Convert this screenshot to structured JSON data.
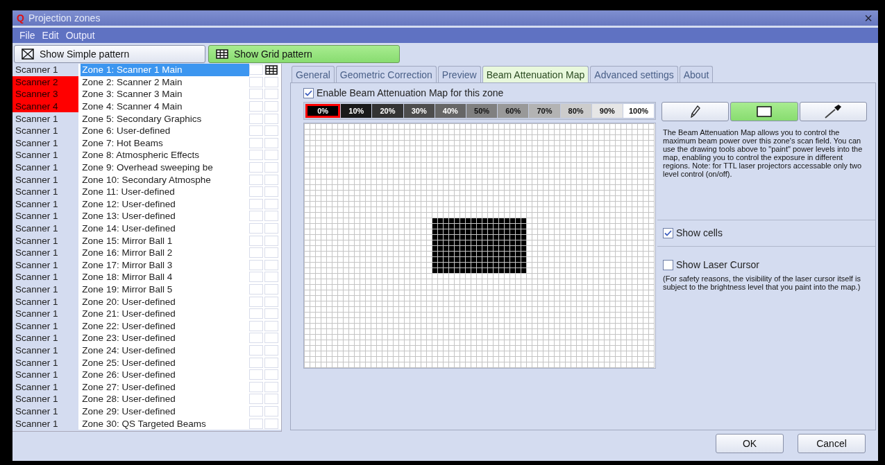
{
  "window": {
    "app_icon": "Q",
    "title": "Projection zones",
    "close": "×"
  },
  "menu": [
    "File",
    "Edit",
    "Output"
  ],
  "toolbar": [
    {
      "label": "Show Simple pattern",
      "kind": "simple",
      "selected": false
    },
    {
      "label": "Show Grid pattern",
      "kind": "grid",
      "selected": true
    }
  ],
  "zones": [
    {
      "scanner": "Scanner 1",
      "name": "Zone 1: Scanner 1 Main",
      "selected": true,
      "conflict": false,
      "simple_pattern": false,
      "grid_pattern": true
    },
    {
      "scanner": "Scanner 2",
      "name": "Zone 2: Scanner 2 Main",
      "selected": false,
      "conflict": true,
      "simple_pattern": false,
      "grid_pattern": false
    },
    {
      "scanner": "Scanner 3",
      "name": "Zone 3: Scanner 3 Main",
      "selected": false,
      "conflict": true,
      "simple_pattern": false,
      "grid_pattern": false
    },
    {
      "scanner": "Scanner 4",
      "name": "Zone 4: Scanner 4 Main",
      "selected": false,
      "conflict": true,
      "simple_pattern": false,
      "grid_pattern": false
    },
    {
      "scanner": "Scanner 1",
      "name": "Zone 5: Secondary Graphics",
      "selected": false,
      "conflict": false,
      "simple_pattern": false,
      "grid_pattern": false
    },
    {
      "scanner": "Scanner 1",
      "name": "Zone 6: User-defined",
      "selected": false,
      "conflict": false,
      "simple_pattern": false,
      "grid_pattern": false
    },
    {
      "scanner": "Scanner 1",
      "name": "Zone 7: Hot Beams",
      "selected": false,
      "conflict": false,
      "simple_pattern": false,
      "grid_pattern": false
    },
    {
      "scanner": "Scanner 1",
      "name": "Zone 8: Atmospheric Effects",
      "selected": false,
      "conflict": false,
      "simple_pattern": false,
      "grid_pattern": false
    },
    {
      "scanner": "Scanner 1",
      "name": "Zone 9: Overhead sweeping be",
      "selected": false,
      "conflict": false,
      "simple_pattern": false,
      "grid_pattern": false
    },
    {
      "scanner": "Scanner 1",
      "name": "Zone 10: Secondary Atmosphe",
      "selected": false,
      "conflict": false,
      "simple_pattern": false,
      "grid_pattern": false
    },
    {
      "scanner": "Scanner 1",
      "name": "Zone 11: User-defined",
      "selected": false,
      "conflict": false,
      "simple_pattern": false,
      "grid_pattern": false
    },
    {
      "scanner": "Scanner 1",
      "name": "Zone 12: User-defined",
      "selected": false,
      "conflict": false,
      "simple_pattern": false,
      "grid_pattern": false
    },
    {
      "scanner": "Scanner 1",
      "name": "Zone 13: User-defined",
      "selected": false,
      "conflict": false,
      "simple_pattern": false,
      "grid_pattern": false
    },
    {
      "scanner": "Scanner 1",
      "name": "Zone 14: User-defined",
      "selected": false,
      "conflict": false,
      "simple_pattern": false,
      "grid_pattern": false
    },
    {
      "scanner": "Scanner 1",
      "name": "Zone 15: Mirror Ball 1",
      "selected": false,
      "conflict": false,
      "simple_pattern": false,
      "grid_pattern": false
    },
    {
      "scanner": "Scanner 1",
      "name": "Zone 16: Mirror Ball 2",
      "selected": false,
      "conflict": false,
      "simple_pattern": false,
      "grid_pattern": false
    },
    {
      "scanner": "Scanner 1",
      "name": "Zone 17: Mirror Ball 3",
      "selected": false,
      "conflict": false,
      "simple_pattern": false,
      "grid_pattern": false
    },
    {
      "scanner": "Scanner 1",
      "name": "Zone 18: Mirror Ball 4",
      "selected": false,
      "conflict": false,
      "simple_pattern": false,
      "grid_pattern": false
    },
    {
      "scanner": "Scanner 1",
      "name": "Zone 19: Mirror Ball 5",
      "selected": false,
      "conflict": false,
      "simple_pattern": false,
      "grid_pattern": false
    },
    {
      "scanner": "Scanner 1",
      "name": "Zone 20: User-defined",
      "selected": false,
      "conflict": false,
      "simple_pattern": false,
      "grid_pattern": false
    },
    {
      "scanner": "Scanner 1",
      "name": "Zone 21: User-defined",
      "selected": false,
      "conflict": false,
      "simple_pattern": false,
      "grid_pattern": false
    },
    {
      "scanner": "Scanner 1",
      "name": "Zone 22: User-defined",
      "selected": false,
      "conflict": false,
      "simple_pattern": false,
      "grid_pattern": false
    },
    {
      "scanner": "Scanner 1",
      "name": "Zone 23: User-defined",
      "selected": false,
      "conflict": false,
      "simple_pattern": false,
      "grid_pattern": false
    },
    {
      "scanner": "Scanner 1",
      "name": "Zone 24: User-defined",
      "selected": false,
      "conflict": false,
      "simple_pattern": false,
      "grid_pattern": false
    },
    {
      "scanner": "Scanner 1",
      "name": "Zone 25: User-defined",
      "selected": false,
      "conflict": false,
      "simple_pattern": false,
      "grid_pattern": false
    },
    {
      "scanner": "Scanner 1",
      "name": "Zone 26: User-defined",
      "selected": false,
      "conflict": false,
      "simple_pattern": false,
      "grid_pattern": false
    },
    {
      "scanner": "Scanner 1",
      "name": "Zone 27: User-defined",
      "selected": false,
      "conflict": false,
      "simple_pattern": false,
      "grid_pattern": false
    },
    {
      "scanner": "Scanner 1",
      "name": "Zone 28: User-defined",
      "selected": false,
      "conflict": false,
      "simple_pattern": false,
      "grid_pattern": false
    },
    {
      "scanner": "Scanner 1",
      "name": "Zone 29: User-defined",
      "selected": false,
      "conflict": false,
      "simple_pattern": false,
      "grid_pattern": false
    },
    {
      "scanner": "Scanner 1",
      "name": "Zone 30: QS Targeted Beams",
      "selected": false,
      "conflict": false,
      "simple_pattern": false,
      "grid_pattern": false
    }
  ],
  "tabs": [
    {
      "label": "General",
      "selected": false
    },
    {
      "label": "Geometric Correction",
      "selected": false
    },
    {
      "label": "Preview",
      "selected": false
    },
    {
      "label": "Beam Attenuation Map",
      "selected": true
    },
    {
      "label": "Advanced settings",
      "selected": false
    },
    {
      "label": "About",
      "selected": false
    }
  ],
  "enable_map": {
    "label": "Enable Beam Attenuation Map for this zone",
    "checked": true
  },
  "levels": [
    {
      "label": "0%",
      "color": "#000000",
      "selected": true
    },
    {
      "label": "10%",
      "color": "#1a1a1a",
      "selected": false
    },
    {
      "label": "20%",
      "color": "#333333",
      "selected": false
    },
    {
      "label": "30%",
      "color": "#4d4d4d",
      "selected": false
    },
    {
      "label": "40%",
      "color": "#666666",
      "selected": false
    },
    {
      "label": "50%",
      "color": "#808080",
      "selected": false
    },
    {
      "label": "60%",
      "color": "#999999",
      "selected": false
    },
    {
      "label": "70%",
      "color": "#b3b3b3",
      "selected": false
    },
    {
      "label": "80%",
      "color": "#cccccc",
      "selected": false
    },
    {
      "label": "90%",
      "color": "#e6e6e6",
      "selected": false
    },
    {
      "label": "100%",
      "color": "#ffffff",
      "selected": false
    }
  ],
  "tools": [
    {
      "kind": "pencil",
      "selected": false
    },
    {
      "kind": "rectangle",
      "selected": true
    },
    {
      "kind": "eyedropper",
      "selected": false
    }
  ],
  "description": "The Beam Attenuation Map allows you to control the maximum beam power over this zone's scan field. You can use the drawing tools above to \"paint\" power levels into the map, enabling you to control the exposure in different regions. Note: for TTL laser projectors accessable only two level control (on/off).",
  "show_cells": {
    "label": "Show cells",
    "checked": true
  },
  "show_laser_cursor": {
    "label": "Show Laser Cursor",
    "checked": false
  },
  "safety_note": "(For safety reasons, the visibility of the laser cursor itself is subject to the brightness level that you paint into the map.)",
  "buttons": [
    "OK",
    "Cancel"
  ]
}
